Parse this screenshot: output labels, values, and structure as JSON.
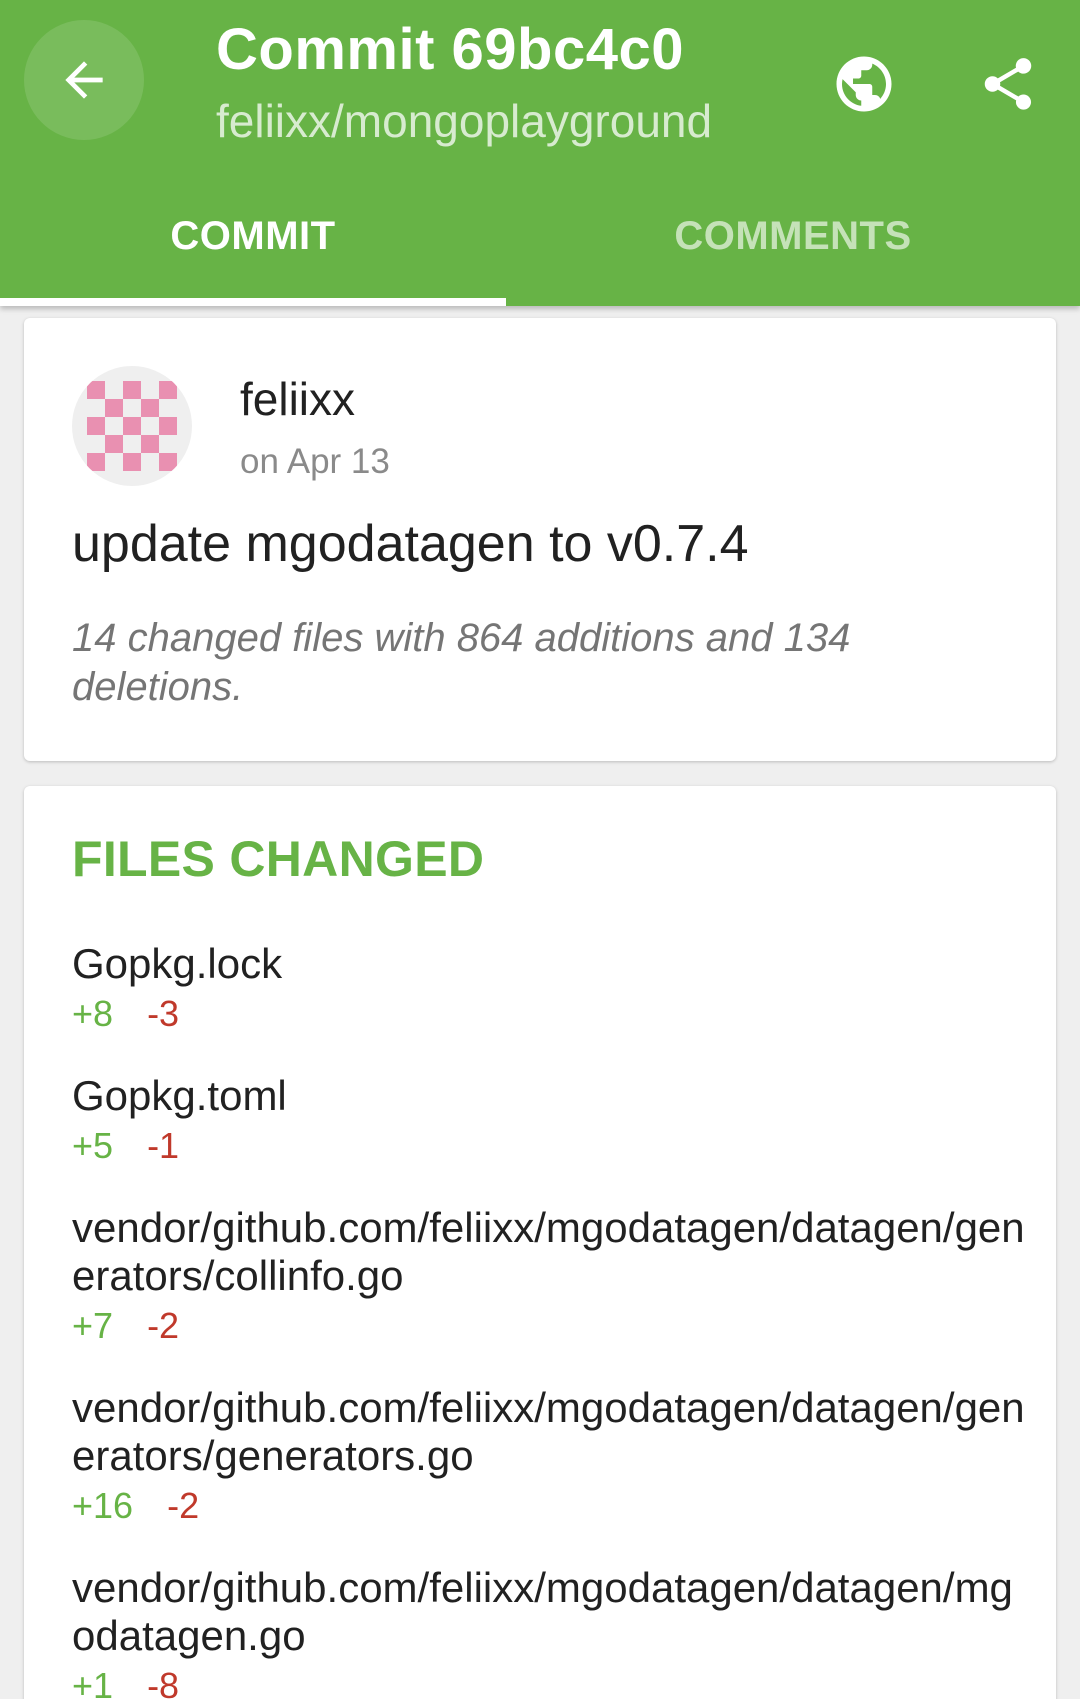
{
  "header": {
    "title": "Commit 69bc4c0",
    "subtitle": "feliixx/mongoplayground",
    "icons": {
      "back": "arrow-back-icon",
      "browser": "globe-icon",
      "share": "share-icon"
    }
  },
  "tabs": [
    {
      "label": "COMMIT",
      "selected": true
    },
    {
      "label": "COMMENTS",
      "selected": false
    }
  ],
  "commit": {
    "author": "feliixx",
    "date": "on Apr 13",
    "message": "update mgodatagen to v0.7.4",
    "summary": "14 changed files with 864 additions and 134 deletions."
  },
  "files_changed": {
    "heading": "FILES CHANGED",
    "files": [
      {
        "name": "Gopkg.lock",
        "additions": "+8",
        "deletions": "-3"
      },
      {
        "name": "Gopkg.toml",
        "additions": "+5",
        "deletions": "-1"
      },
      {
        "name": "vendor/github.com/feliixx/mgodatagen/datagen/generators/collinfo.go",
        "additions": "+7",
        "deletions": "-2"
      },
      {
        "name": "vendor/github.com/feliixx/mgodatagen/datagen/generators/generators.go",
        "additions": "+16",
        "deletions": "-2"
      },
      {
        "name": "vendor/github.com/feliixx/mgodatagen/datagen/mgodatagen.go",
        "additions": "+1",
        "deletions": "-8"
      }
    ]
  },
  "colors": {
    "primary": "#67b346",
    "addition": "#67b346",
    "deletion": "#c0392b",
    "avatar_pattern": "#e990b1"
  }
}
